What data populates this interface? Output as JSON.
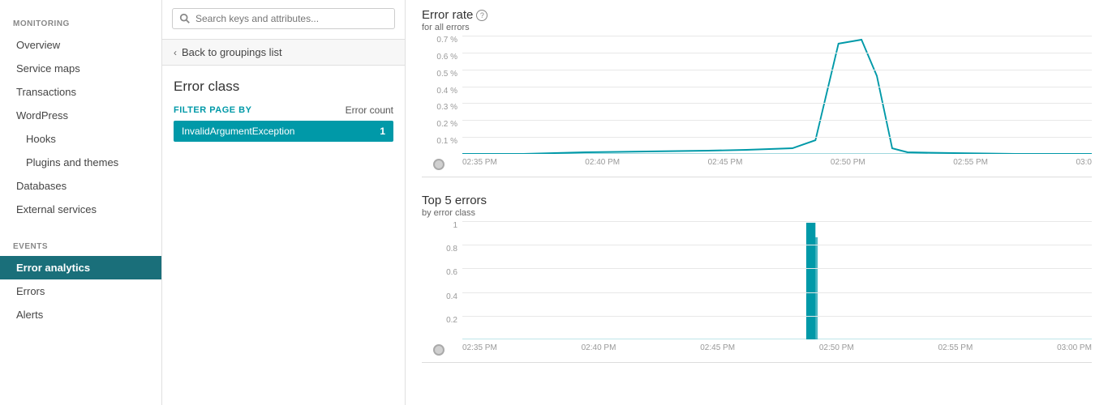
{
  "sidebar": {
    "monitoring_label": "MONITORING",
    "events_label": "EVENTS",
    "items_monitoring": [
      {
        "label": "Overview",
        "active": false,
        "sub": false,
        "name": "overview"
      },
      {
        "label": "Service maps",
        "active": false,
        "sub": false,
        "name": "service-maps"
      },
      {
        "label": "Transactions",
        "active": false,
        "sub": false,
        "name": "transactions"
      },
      {
        "label": "WordPress",
        "active": false,
        "sub": false,
        "name": "wordpress"
      },
      {
        "label": "Hooks",
        "active": false,
        "sub": true,
        "name": "hooks"
      },
      {
        "label": "Plugins and themes",
        "active": false,
        "sub": true,
        "name": "plugins-and-themes"
      },
      {
        "label": "Databases",
        "active": false,
        "sub": false,
        "name": "databases"
      },
      {
        "label": "External services",
        "active": false,
        "sub": false,
        "name": "external-services"
      }
    ],
    "items_events": [
      {
        "label": "Error analytics",
        "active": true,
        "sub": false,
        "name": "error-analytics"
      },
      {
        "label": "Errors",
        "active": false,
        "sub": false,
        "name": "errors"
      },
      {
        "label": "Alerts",
        "active": false,
        "sub": false,
        "name": "alerts"
      }
    ]
  },
  "middle": {
    "search_placeholder": "Search keys and attributes...",
    "back_label": "Back to groupings list",
    "error_class_title": "Error class",
    "filter_label": "FILTER PAGE BY",
    "error_count_label": "Error count",
    "filter_item": "InvalidArgumentException",
    "filter_count": "1"
  },
  "charts": {
    "error_rate": {
      "title": "Error rate",
      "subtitle": "for all errors",
      "help": "?",
      "y_labels": [
        "0.7 %",
        "0.6 %",
        "0.5 %",
        "0.4 %",
        "0.3 %",
        "0.2 %",
        "0.1 %",
        ""
      ],
      "x_labels": [
        "02:35 PM",
        "02:40 PM",
        "02:45 PM",
        "02:50 PM",
        "02:55 PM",
        "03:0"
      ]
    },
    "top5": {
      "title": "Top 5 errors",
      "subtitle": "by error class",
      "y_labels": [
        "1",
        "0.8",
        "0.6",
        "0.4",
        "0.2",
        ""
      ],
      "x_labels": [
        "02:35 PM",
        "02:40 PM",
        "02:45 PM",
        "02:50 PM",
        "02:55 PM",
        "03:00 PM"
      ]
    }
  },
  "colors": {
    "accent": "#0099a8",
    "active_sidebar": "#1a6f7a"
  }
}
